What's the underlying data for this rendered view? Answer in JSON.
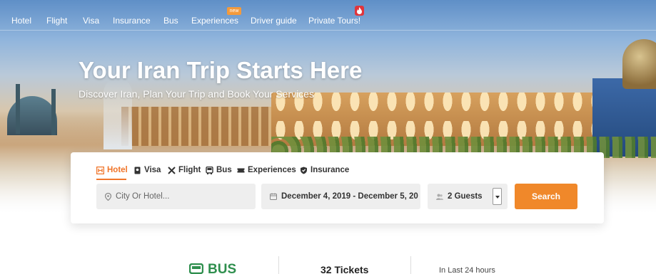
{
  "nav": {
    "items": [
      {
        "label": "Hotel"
      },
      {
        "label": "Flight"
      },
      {
        "label": "Visa"
      },
      {
        "label": "Insurance"
      },
      {
        "label": "Bus"
      },
      {
        "label": "Experiences",
        "badge": "new"
      },
      {
        "label": "Driver guide"
      },
      {
        "label": "Private Tours!"
      }
    ]
  },
  "hero": {
    "title": "Your Iran Trip Starts Here",
    "subtitle": "Discover Iran, Plan Your Trip and Book Your Services"
  },
  "search": {
    "tabs": [
      {
        "label": "Hotel",
        "icon": "hotel-icon",
        "active": true
      },
      {
        "label": "Visa",
        "icon": "passport-icon"
      },
      {
        "label": "Flight",
        "icon": "plane-icon"
      },
      {
        "label": "Bus",
        "icon": "bus-icon"
      },
      {
        "label": "Experiences",
        "icon": "ticket-icon"
      },
      {
        "label": "Insurance",
        "icon": "shield-icon"
      }
    ],
    "location_placeholder": "City Or Hotel...",
    "dates": "December 4, 2019 - December 5, 20",
    "guests": "2 Guests",
    "button_label": "Search"
  },
  "stats": {
    "category": "BUS",
    "count": "32 Tickets",
    "period": "In Last 24 hours"
  },
  "colors": {
    "accent": "#f0752a",
    "button": "#f0882a",
    "bus_green": "#2f8f4e"
  }
}
